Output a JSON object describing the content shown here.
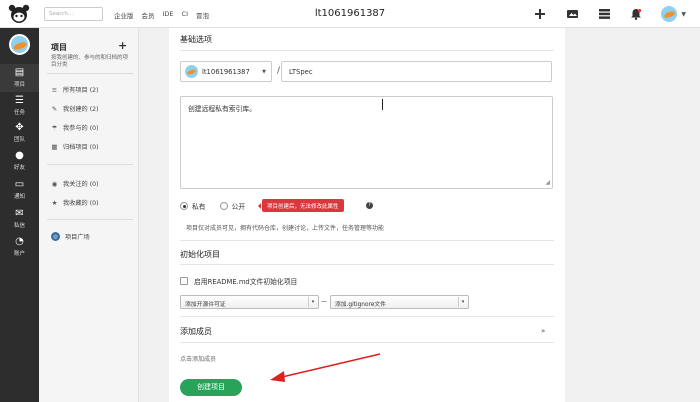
{
  "topbar": {
    "search_placeholder": "Search...",
    "nav": [
      "企业版",
      "会员",
      "IDE",
      "CI",
      "冒泡"
    ],
    "title": "lt1061961387"
  },
  "rail": {
    "items": [
      {
        "label": "项目",
        "icon": "project-icon",
        "glyph": "▤"
      },
      {
        "label": "任务",
        "icon": "task-icon",
        "glyph": "☰"
      },
      {
        "label": "团队",
        "icon": "team-icon",
        "glyph": "✥"
      },
      {
        "label": "好友",
        "icon": "friend-icon",
        "glyph": "●"
      },
      {
        "label": "通知",
        "icon": "inbox-icon",
        "glyph": "▭"
      },
      {
        "label": "私信",
        "icon": "mail-icon",
        "glyph": "✉"
      },
      {
        "label": "账户",
        "icon": "dashboard-icon",
        "glyph": "◔"
      }
    ]
  },
  "sidebar": {
    "title": "项目",
    "description": "按我创建的、参与的和归档的项目分类",
    "items": [
      {
        "label": "所有项目 (2)",
        "icon": "list-icon",
        "glyph": "≡"
      },
      {
        "label": "我创建的 (2)",
        "icon": "edit-icon",
        "glyph": "✎"
      },
      {
        "label": "我参与的 (0)",
        "icon": "umbrella-icon",
        "glyph": "☂"
      },
      {
        "label": "归档项目 (0)",
        "icon": "archive-icon",
        "glyph": "▦"
      },
      {
        "label": "我关注的 (0)",
        "icon": "eye-icon",
        "glyph": "◉"
      },
      {
        "label": "我收藏的 (0)",
        "icon": "star-icon",
        "glyph": "★"
      },
      {
        "label": "项目广场",
        "icon": "plaza-icon",
        "glyph": "◎"
      }
    ]
  },
  "form": {
    "basic_title": "基础选项",
    "owner": "lt1061961387",
    "slash": "/",
    "project_name": "LTSpec",
    "description": "创建远程私有索引库。",
    "private_label": "私有",
    "public_label": "公开",
    "tooltip": "项目创建后，无法修改此属性",
    "help_glyph": "?",
    "visibility_note": "项目仅对成员可见，拥有代码仓库，创建讨论，上传文件，任务管理等功能",
    "init_title": "初始化项目",
    "readme_label": "启用README.md文件初始化项目",
    "license_select": "添加开源许可证",
    "dash": "—",
    "gitignore_select": "添加.gitignore文件",
    "members_title": "添加成员",
    "add_member_hint": "点击添加成员",
    "submit_label": "创建项目"
  }
}
